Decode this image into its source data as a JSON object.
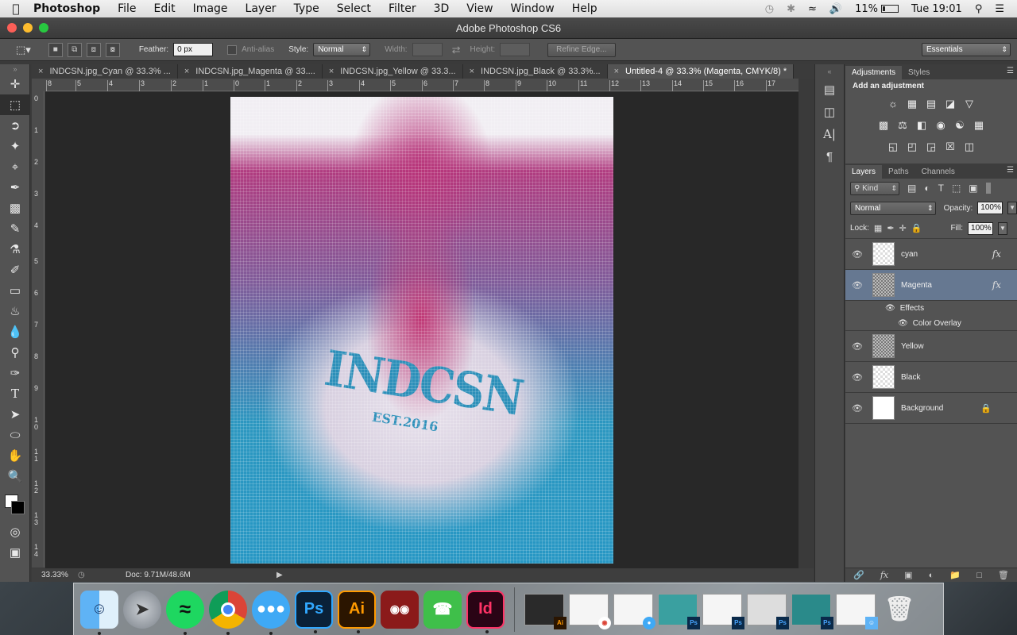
{
  "menubar": {
    "apple": "",
    "app": "Photoshop",
    "items": [
      "File",
      "Edit",
      "Image",
      "Layer",
      "Type",
      "Select",
      "Filter",
      "3D",
      "View",
      "Window",
      "Help"
    ],
    "battery": "11%",
    "clock": "Tue 19:01"
  },
  "window": {
    "title": "Adobe Photoshop CS6"
  },
  "options": {
    "feather_label": "Feather:",
    "feather_value": "0 px",
    "antialias_label": "Anti-alias",
    "style_label": "Style:",
    "style_value": "Normal",
    "width_label": "Width:",
    "height_label": "Height:",
    "refine_edge": "Refine Edge...",
    "workspace": "Essentials"
  },
  "doc_tabs": [
    {
      "label": "INDCSN.jpg_Cyan @ 33.3% ..."
    },
    {
      "label": "INDCSN.jpg_Magenta @ 33...."
    },
    {
      "label": "INDCSN.jpg_Yellow @ 33.3..."
    },
    {
      "label": "INDCSN.jpg_Black @ 33.3%..."
    },
    {
      "label": "Untitled-4 @ 33.3% (Magenta, CMYK/8) *"
    }
  ],
  "ruler": {
    "h_ticks": [
      "8",
      "5",
      "4",
      "3",
      "2",
      "1",
      "0",
      "1",
      "2",
      "3",
      "4",
      "5",
      "6",
      "7",
      "8",
      "9",
      "10",
      "11",
      "12",
      "13",
      "14",
      "15",
      "16",
      "17"
    ],
    "v_ticks": [
      "0",
      "1",
      "2",
      "3",
      "4",
      "5",
      "6",
      "7",
      "8",
      "9",
      "1\n0",
      "1\n1",
      "1\n2",
      "1\n3",
      "1\n4"
    ]
  },
  "canvas": {
    "shirt_text": "INDCSN",
    "shirt_sub": "EST.2016"
  },
  "status": {
    "zoom": "33.33%",
    "doc": "Doc: 9.71M/48.6M"
  },
  "panels": {
    "adjustments_tab": "Adjustments",
    "styles_tab": "Styles",
    "add_adjustment": "Add an adjustment",
    "layers_tab": "Layers",
    "paths_tab": "Paths",
    "channels_tab": "Channels",
    "kind": "Kind",
    "blend_mode": "Normal",
    "opacity_label": "Opacity:",
    "opacity_value": "100%",
    "lock_label": "Lock:",
    "fill_label": "Fill:",
    "fill_value": "100%"
  },
  "layers": [
    {
      "name": "cyan",
      "fx": "fx"
    },
    {
      "name": "Magenta",
      "fx": "fx"
    },
    {
      "name": "Yellow"
    },
    {
      "name": "Black"
    },
    {
      "name": "Background"
    }
  ],
  "effects": {
    "label": "Effects",
    "color_overlay": "Color Overlay"
  },
  "dock": {
    "apps": [
      "Finder",
      "Launchpad",
      "Spotify",
      "Chrome",
      "Messages",
      "Ps",
      "Ai",
      "Photo Booth",
      "FaceTime",
      "Id"
    ]
  }
}
